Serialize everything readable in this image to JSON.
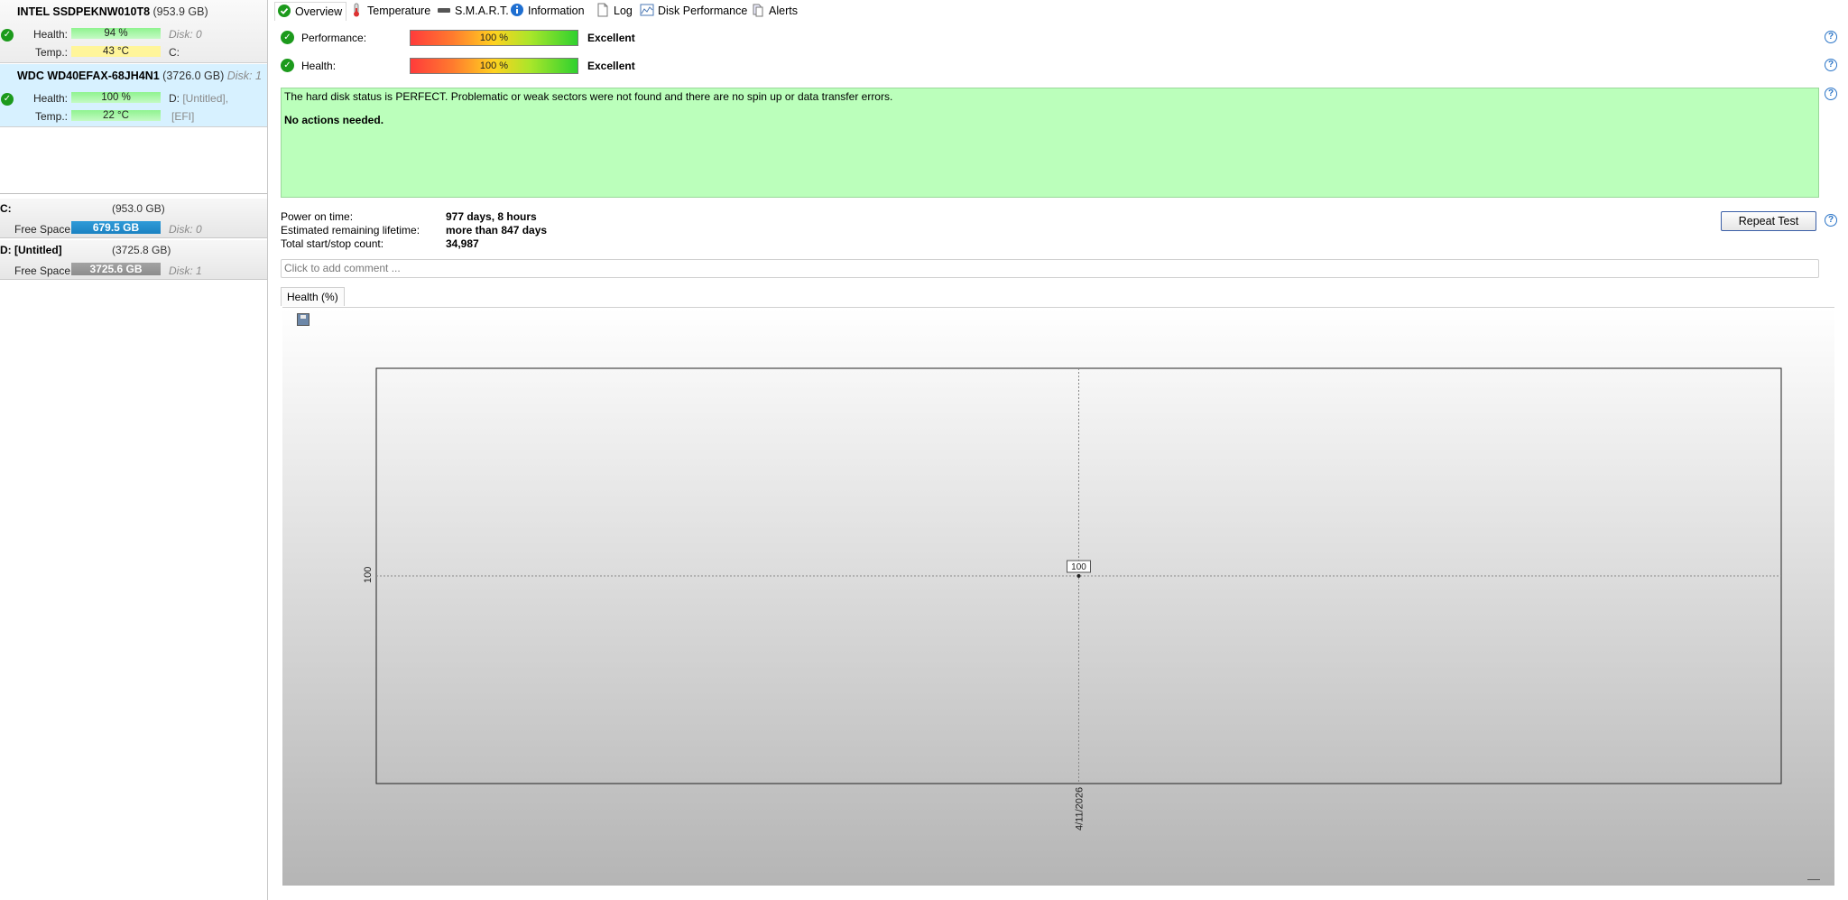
{
  "disks": [
    {
      "name": "INTEL SSDPEKNW010T8",
      "size": "(953.9 GB)",
      "disk_label": "",
      "health_label": "Health:",
      "health_value": "94 %",
      "health_fraction": 0.94,
      "health_note": "Disk: 0",
      "temp_label": "Temp.:",
      "temp_value": "43 °C",
      "temp_note": "C:"
    },
    {
      "name": "WDC WD40EFAX-68JH4N1",
      "size": "(3726.0 GB)",
      "disk_label": "Disk: 1",
      "health_label": "Health:",
      "health_value": "100 %",
      "health_fraction": 1.0,
      "health_note_prefix": "D:",
      "health_note": "[Untitled],",
      "temp_label": "Temp.:",
      "temp_value": "22 °C",
      "temp_note": "[EFI]"
    }
  ],
  "volumes": [
    {
      "name": "C:",
      "size": "(953.0 GB)",
      "free_label": "Free Space",
      "free_value": "679.5 GB",
      "disk": "Disk: 0"
    },
    {
      "name": "D: [Untitled]",
      "size": "(3725.8 GB)",
      "free_label": "Free Space",
      "free_value": "3725.6 GB",
      "disk": "Disk: 1"
    }
  ],
  "tabs": [
    "Overview",
    "Temperature",
    "S.M.A.R.T.",
    "Information",
    "Log",
    "Disk Performance",
    "Alerts"
  ],
  "metrics": {
    "performance": {
      "label": "Performance:",
      "bar": "100 %",
      "word": "Excellent",
      "fraction": 1.0
    },
    "health": {
      "label": "Health:",
      "bar": "100 %",
      "word": "Excellent",
      "fraction": 1.0
    }
  },
  "status": {
    "line1": "The hard disk status is PERFECT. Problematic or weak sectors were not found and there are no spin up or data transfer errors.",
    "line2": "No actions needed."
  },
  "info": [
    {
      "label": "Power on time:",
      "value": "977 days, 8 hours"
    },
    {
      "label": "Estimated remaining lifetime:",
      "value": "more than 847 days"
    },
    {
      "label": "Total start/stop count:",
      "value": "34,987"
    }
  ],
  "repeat_button": "Repeat Test",
  "comment_placeholder": "Click to add comment ...",
  "chart_tab": "Health (%)",
  "chart_data": {
    "type": "line",
    "title": "Health (%)",
    "x": [
      "4/11/2026"
    ],
    "series": [
      {
        "values": [
          100
        ]
      }
    ],
    "data_labels": [
      "100"
    ],
    "y_tick_labels": [
      "100"
    ],
    "grid": true
  },
  "colors": {
    "status_bg": "#bbffbb",
    "ok_green": "#1c9a1c",
    "selected_disk_bg": "#d7f1ff",
    "free_space_blue": "#1b82c2",
    "free_space_grey": "#8d8d8d"
  }
}
